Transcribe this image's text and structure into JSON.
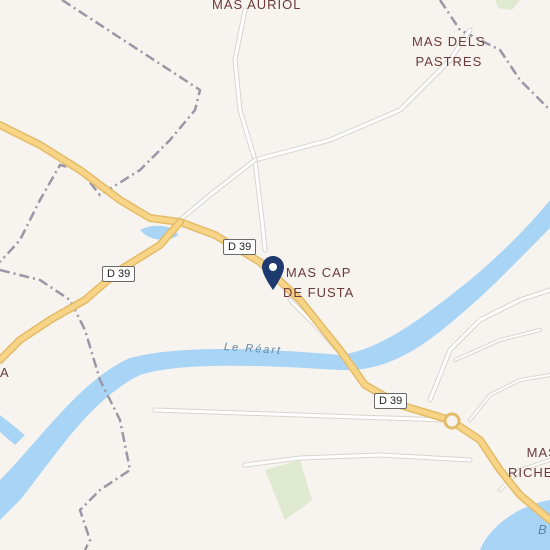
{
  "map": {
    "colors": {
      "land": "#f7f3ef",
      "water": "#a8d4f5",
      "road_major": "#f7d486",
      "road_major_casing": "#e3bc6a",
      "road_minor": "#ffffff",
      "road_minor_casing": "#d9d4cf",
      "boundary": "#9a97a6",
      "park": "#dfe9cf",
      "marker": "#1f3a6e"
    },
    "places": [
      {
        "id": "mas-auriol",
        "text": "MAS AURIOL"
      },
      {
        "id": "mas-dels-pastres",
        "text": "MAS DELS\nPASTRES"
      },
      {
        "id": "mas-cap-de-fusta",
        "text": "MAS CAP\nDE FUSTA"
      },
      {
        "id": "mas-richemo",
        "text": "MAS\nRICHEMO"
      },
      {
        "id": "a-left",
        "text": "A"
      }
    ],
    "road_shields": [
      {
        "id": "d39-a",
        "text": "D 39"
      },
      {
        "id": "d39-b",
        "text": "D 39"
      },
      {
        "id": "d39-c",
        "text": "D 39"
      }
    ],
    "river_label": "Le Réart",
    "edge_label": "B",
    "marker_icon": "map-pin-icon"
  }
}
